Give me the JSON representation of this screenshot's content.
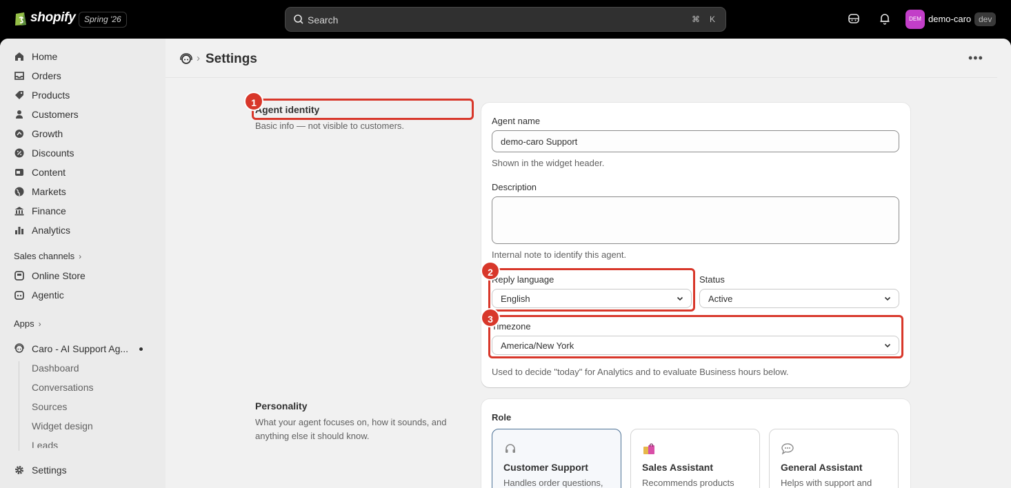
{
  "topbar": {
    "logo_text": "shopify",
    "edition": "Spring '26",
    "search_placeholder": "Search",
    "shortcut_cmd": "⌘",
    "shortcut_key": "K",
    "avatar_initials": "DEM",
    "store_name": "demo-caro",
    "env_badge": "dev"
  },
  "sidebar": {
    "items": [
      {
        "label": "Home",
        "icon": "home-icon"
      },
      {
        "label": "Orders",
        "icon": "inbox-icon"
      },
      {
        "label": "Products",
        "icon": "tag-icon"
      },
      {
        "label": "Customers",
        "icon": "person-icon"
      },
      {
        "label": "Growth",
        "icon": "growth-icon"
      },
      {
        "label": "Discounts",
        "icon": "discount-icon"
      },
      {
        "label": "Content",
        "icon": "content-icon"
      },
      {
        "label": "Markets",
        "icon": "globe-icon"
      },
      {
        "label": "Finance",
        "icon": "bank-icon"
      },
      {
        "label": "Analytics",
        "icon": "bar-chart-icon"
      }
    ],
    "sales_channels_label": "Sales channels",
    "channels": [
      {
        "label": "Online Store",
        "icon": "store-icon"
      },
      {
        "label": "Agentic",
        "icon": "robot-icon"
      }
    ],
    "apps_label": "Apps",
    "app_name": "Caro - AI Support Ag...",
    "app_subitems": [
      "Dashboard",
      "Conversations",
      "Sources",
      "Widget design",
      "Leads"
    ],
    "settings_label": "Settings"
  },
  "header": {
    "title": "Settings"
  },
  "agent_identity": {
    "title": "Agent identity",
    "description": "Basic info — not visible to customers.",
    "agent_name_label": "Agent name",
    "agent_name_value": "demo-caro Support",
    "agent_name_help": "Shown in the widget header.",
    "description_label": "Description",
    "description_value": "",
    "description_help": "Internal note to identify this agent.",
    "reply_language_label": "Reply language",
    "reply_language_value": "English",
    "status_label": "Status",
    "status_value": "Active",
    "timezone_label": "Timezone",
    "timezone_value": "America/New York",
    "timezone_help": "Used to decide \"today\" for Analytics and to evaluate Business hours below."
  },
  "personality": {
    "title": "Personality",
    "description": "What your agent focuses on, how it sounds, and anything else it should know.",
    "role_label": "Role",
    "roles": [
      {
        "title": "Customer Support",
        "desc": "Handles order questions,",
        "icon": "headphones-icon",
        "emoji": "🎧",
        "selected": true
      },
      {
        "title": "Sales Assistant",
        "desc": "Recommends products",
        "icon": "shopping-bags-icon",
        "emoji": "🛍️",
        "selected": false
      },
      {
        "title": "General Assistant",
        "desc": "Helps with support and",
        "icon": "speech-bubble-icon",
        "emoji": "💬",
        "selected": false
      }
    ]
  },
  "annotations": {
    "marker_1": "1",
    "marker_2": "2",
    "marker_3": "3",
    "color": "#d8372a"
  }
}
